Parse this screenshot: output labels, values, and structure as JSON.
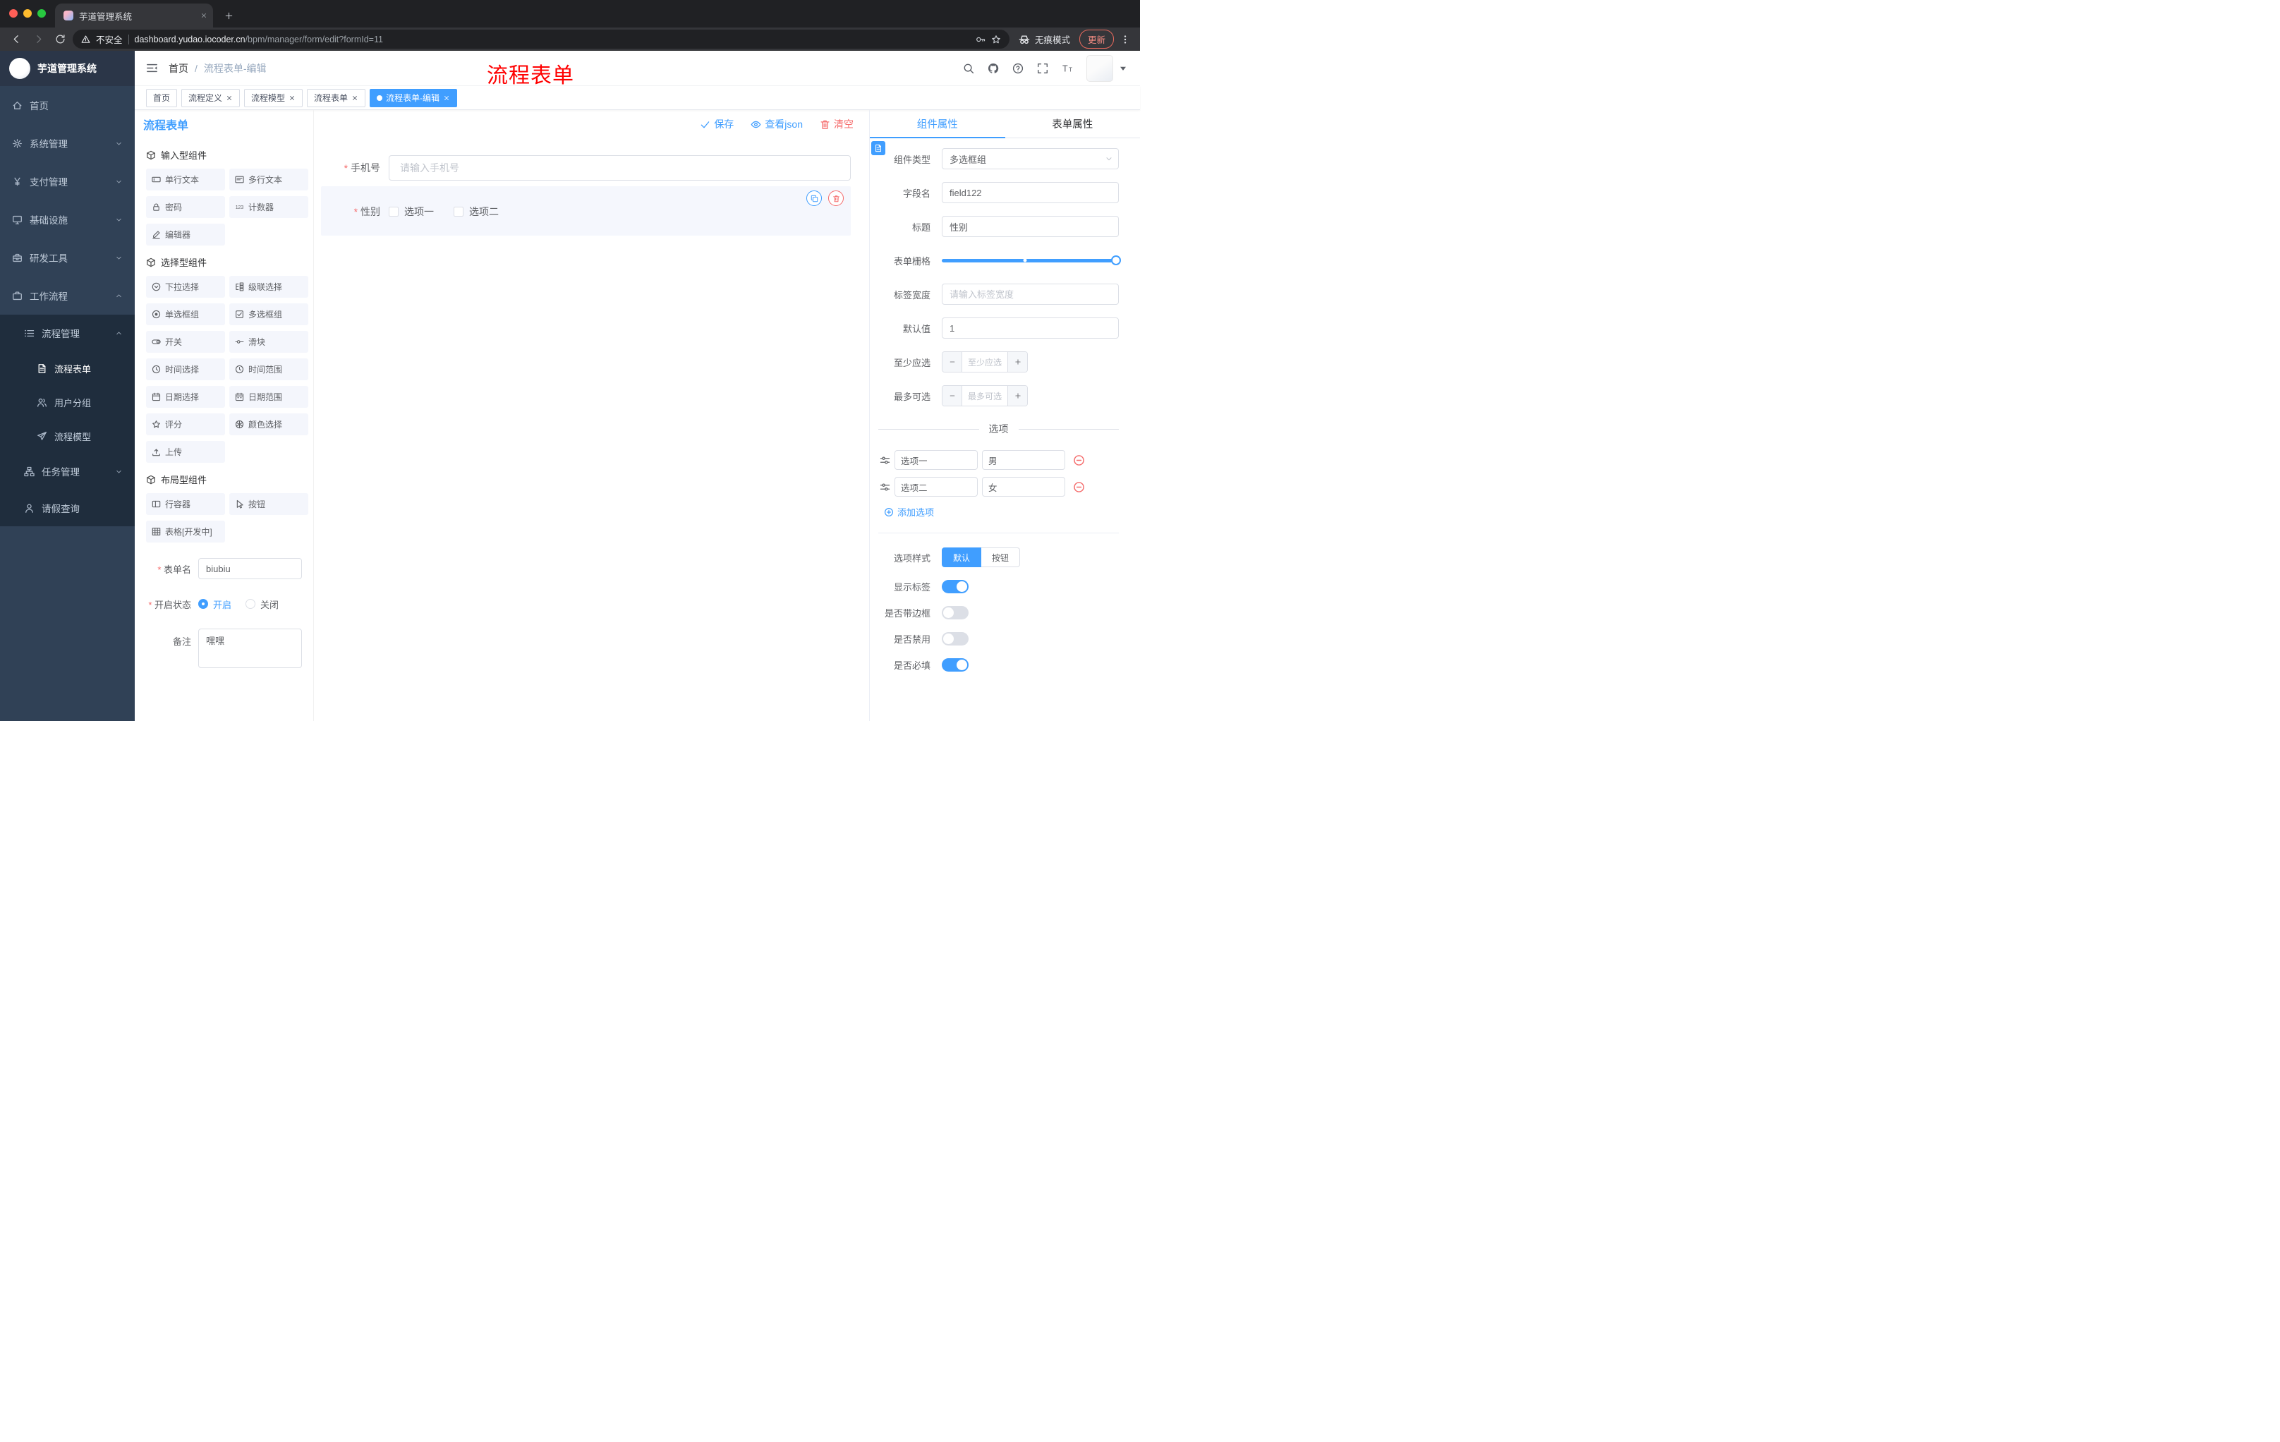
{
  "colors": {
    "primary": "#409eff",
    "danger": "#f56c6c",
    "annotation_red": "#ff0000",
    "sidebar_bg": "#304156",
    "sidebar_sub_bg": "#1f2d3d"
  },
  "browser": {
    "tab_title": "芋道管理系统",
    "security_label": "不安全",
    "url_host": "dashboard.yudao.iocoder.cn",
    "url_path": "/bpm/manager/form/edit?formId=11",
    "incognito_label": "无痕模式",
    "update_label": "更新"
  },
  "sidebar": {
    "title": "芋道管理系统",
    "menu": [
      {
        "id": "home",
        "icon": "home",
        "label": "首页",
        "level": 0
      },
      {
        "id": "system",
        "icon": "gear",
        "label": "系统管理",
        "level": 0,
        "chevron": "down"
      },
      {
        "id": "payment",
        "icon": "yen",
        "label": "支付管理",
        "level": 0,
        "chevron": "down"
      },
      {
        "id": "infra",
        "icon": "monitor",
        "label": "基础设施",
        "level": 0,
        "chevron": "down"
      },
      {
        "id": "devtools",
        "icon": "toolbox",
        "label": "研发工具",
        "level": 0,
        "chevron": "down"
      },
      {
        "id": "workflow",
        "icon": "briefcase",
        "label": "工作流程",
        "level": 0,
        "chevron": "up"
      },
      {
        "id": "process-mgmt",
        "icon": "list",
        "label": "流程管理",
        "level": 1,
        "chevron": "up"
      },
      {
        "id": "process-form",
        "icon": "doc",
        "label": "流程表单",
        "level": 2,
        "active": true
      },
      {
        "id": "user-group",
        "icon": "users",
        "label": "用户分组",
        "level": 2
      },
      {
        "id": "process-model",
        "icon": "send",
        "label": "流程模型",
        "level": 2
      },
      {
        "id": "task-mgmt",
        "icon": "tree",
        "label": "任务管理",
        "level": 1,
        "chevron": "down"
      },
      {
        "id": "leave-query",
        "icon": "person",
        "label": "请假查询",
        "level": 1
      }
    ]
  },
  "header": {
    "breadcrumb_home": "首页",
    "breadcrumb_current": "流程表单-编辑",
    "overlay_title": "流程表单"
  },
  "tabbar": [
    {
      "id": "home",
      "label": "首页"
    },
    {
      "id": "process-definition",
      "label": "流程定义",
      "closable": true
    },
    {
      "id": "process-model",
      "label": "流程模型",
      "closable": true
    },
    {
      "id": "process-form",
      "label": "流程表单",
      "closable": true
    },
    {
      "id": "process-form-edit",
      "label": "流程表单-编辑",
      "closable": true,
      "active": true
    }
  ],
  "designer": {
    "title": "流程表单",
    "save_label": "保存",
    "json_label": "查看json",
    "clear_label": "清空",
    "palette": [
      {
        "title": "输入型组件",
        "items": [
          {
            "icon": "text-field",
            "label": "单行文本"
          },
          {
            "icon": "textarea",
            "label": "多行文本"
          },
          {
            "icon": "lock",
            "label": "密码"
          },
          {
            "icon": "counter",
            "label": "计数器"
          },
          {
            "icon": "editor",
            "label": "编辑器"
          }
        ]
      },
      {
        "title": "选择型组件",
        "items": [
          {
            "icon": "select",
            "label": "下拉选择"
          },
          {
            "icon": "cascade",
            "label": "级联选择"
          },
          {
            "icon": "radio",
            "label": "单选框组"
          },
          {
            "icon": "checkbox",
            "label": "多选框组"
          },
          {
            "icon": "switch",
            "label": "开关"
          },
          {
            "icon": "slider-ic",
            "label": "滑块"
          },
          {
            "icon": "clock",
            "label": "时间选择"
          },
          {
            "icon": "clock",
            "label": "时间范围"
          },
          {
            "icon": "calendar",
            "label": "日期选择"
          },
          {
            "icon": "date-range",
            "label": "日期范围"
          },
          {
            "icon": "star",
            "label": "评分"
          },
          {
            "icon": "color",
            "label": "颜色选择"
          },
          {
            "icon": "upload",
            "label": "上传"
          }
        ]
      },
      {
        "title": "布局型组件",
        "items": [
          {
            "icon": "row-container",
            "label": "行容器"
          },
          {
            "icon": "button-ic",
            "label": "按钮"
          },
          {
            "icon": "table",
            "label": "表格[开发中]"
          }
        ]
      }
    ],
    "meta": {
      "name_label": "表单名",
      "name_value": "biubiu",
      "status_label": "开启状态",
      "status_on": "开启",
      "status_off": "关闭",
      "remark_label": "备注",
      "remark_value": "嘿嘿"
    },
    "canvas": {
      "phone_label": "手机号",
      "phone_placeholder": "请输入手机号",
      "gender_label": "性别",
      "option1": "选项一",
      "option2": "选项二"
    }
  },
  "props": {
    "tab_component": "组件属性",
    "tab_form": "表单属性",
    "component_type_label": "组件类型",
    "component_type_value": "多选框组",
    "field_name_label": "字段名",
    "field_name_value": "field122",
    "title_label": "标题",
    "title_value": "性别",
    "grid_label": "表单栅格",
    "label_width_label": "标签宽度",
    "label_width_placeholder": "请输入标签宽度",
    "default_label": "默认值",
    "default_value": "1",
    "min_label": "至少应选",
    "min_placeholder": "至少应选",
    "max_label": "最多可选",
    "max_placeholder": "最多可选",
    "options_title": "选项",
    "options": [
      {
        "label": "选项一",
        "value": "男"
      },
      {
        "label": "选项二",
        "value": "女"
      }
    ],
    "add_option_label": "添加选项",
    "style_label": "选项样式",
    "style_options": [
      "默认",
      "按钮"
    ],
    "style_active": "默认",
    "toggles": [
      {
        "label": "显示标签",
        "on": true
      },
      {
        "label": "是否带边框",
        "on": false
      },
      {
        "label": "是否禁用",
        "on": false
      },
      {
        "label": "是否必填",
        "on": true
      }
    ]
  }
}
